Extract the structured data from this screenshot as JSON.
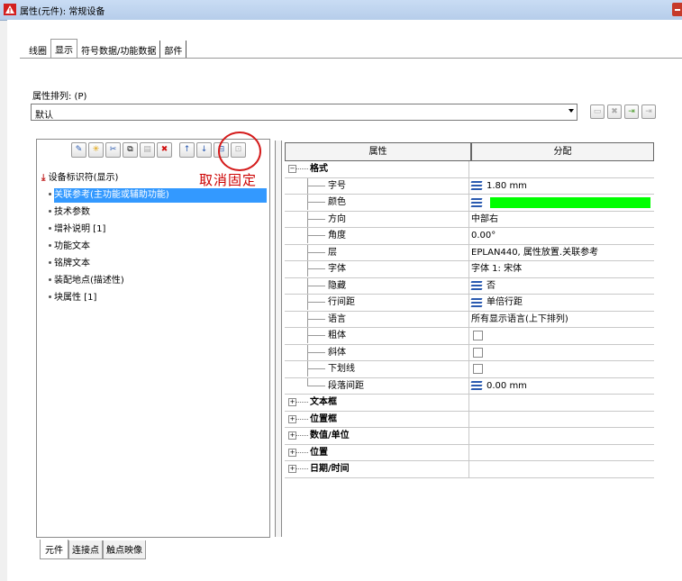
{
  "window": {
    "title": "属性(元件): 常规设备",
    "app_icon": "warning-triangle-icon"
  },
  "tabs": [
    "线圈",
    "显示",
    "符号数据/功能数据",
    "部件"
  ],
  "sort": {
    "label": "属性排列: (P)",
    "value": "默认"
  },
  "tree": {
    "root": "设备标识符(显示)",
    "items": [
      "关联参考(主功能或辅助功能)",
      "技术参数",
      "增补说明 [1]",
      "功能文本",
      "铭牌文本",
      "装配地点(描述性)",
      "块属性 [1]"
    ]
  },
  "annotation": "取消固定",
  "grid": {
    "headers": {
      "property": "属性",
      "value": "分配"
    },
    "group_format": "格式",
    "rows": [
      {
        "name": "字号",
        "value": "1.80 mm"
      },
      {
        "name": "颜色",
        "value": ""
      },
      {
        "name": "方向",
        "value": "中部右"
      },
      {
        "name": "角度",
        "value": "0.00°"
      },
      {
        "name": "层",
        "value": "EPLAN440, 属性放置.关联参考"
      },
      {
        "name": "字体",
        "value": "字体 1: 宋体"
      },
      {
        "name": "隐藏",
        "value": "否"
      },
      {
        "name": "行间距",
        "value": "单倍行距"
      },
      {
        "name": "语言",
        "value": "所有显示语言(上下排列)"
      },
      {
        "name": "粗体",
        "value": ""
      },
      {
        "name": "斜体",
        "value": ""
      },
      {
        "name": "下划线",
        "value": ""
      },
      {
        "name": "段落间距",
        "value": "0.00 mm"
      }
    ],
    "groups": [
      "文本框",
      "位置框",
      "数值/单位",
      "位置",
      "日期/时间"
    ]
  },
  "bottom_tabs": [
    "元件",
    "连接点",
    "触点映像"
  ],
  "colors": {
    "selection": "#3399ff",
    "color_swatch": "#00ff00",
    "annotation": "#cc0000"
  }
}
